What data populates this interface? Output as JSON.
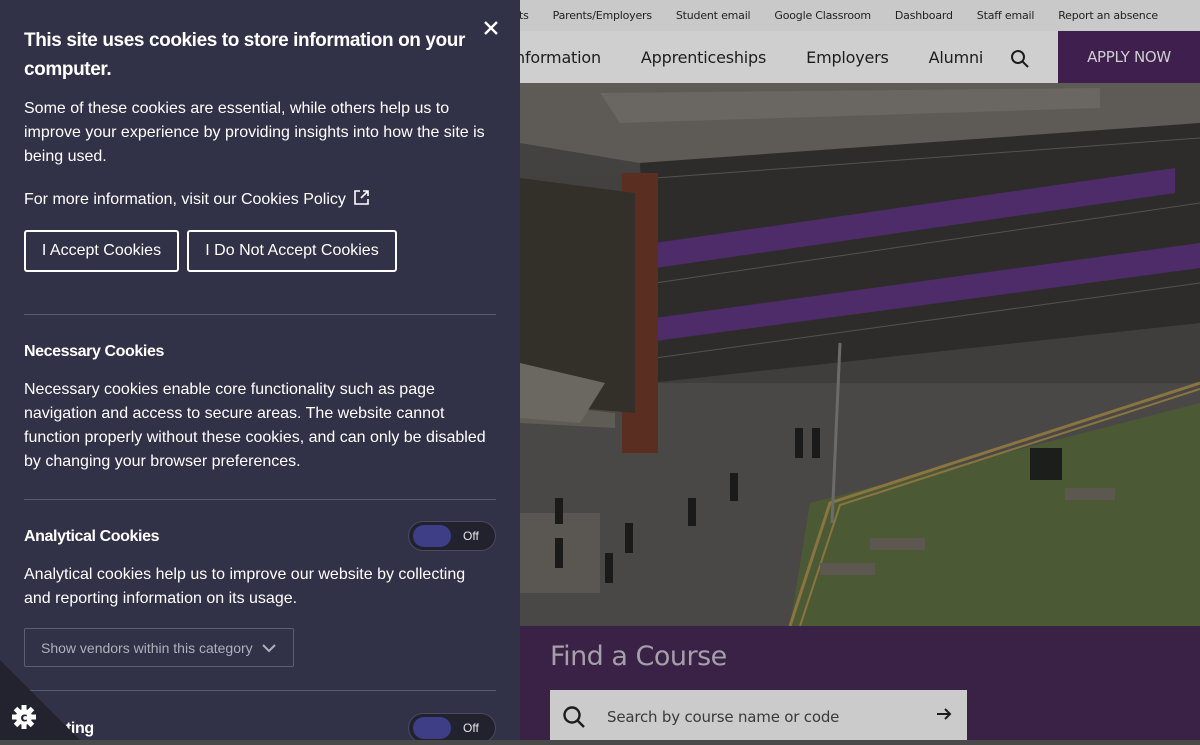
{
  "site": {
    "utility_links": [
      "yments",
      "Parents/Employers",
      "Student email",
      "Google Classroom",
      "Dashboard",
      "Staff email",
      "Report an absence"
    ],
    "nav_items": [
      "nformation",
      "Apprenticeships",
      "Employers",
      "Alumni"
    ],
    "apply_label": "APPLY NOW",
    "course_title": "Find a Course",
    "course_search_placeholder": "Search by course name or code"
  },
  "cookie_panel": {
    "title": "This site uses cookies to store information on your computer.",
    "intro": "Some of these cookies are essential, while others help us to improve your experience by providing insights into how the site is being used.",
    "more_info": "For more information, visit our Cookies Policy",
    "accept_label": "I Accept Cookies",
    "decline_label": "I Do Not Accept Cookies",
    "necessary_title": "Necessary Cookies",
    "necessary_text": "Necessary cookies enable core functionality such as page navigation and access to secure areas. The website cannot function properly without these cookies, and can only be disabled by changing your browser preferences.",
    "analytical_title": "Analytical Cookies",
    "analytical_toggle": "Off",
    "analytical_text": "Analytical cookies help us to improve our website by collecting and reporting information on its usage.",
    "vendors_label": "Show vendors within this category",
    "marketing_title_visible": "ting",
    "marketing_toggle": "Off"
  },
  "colors": {
    "panel_bg": "#313147",
    "brand_purple": "#3e1f4d",
    "toggle_knob": "#3e3e86"
  }
}
